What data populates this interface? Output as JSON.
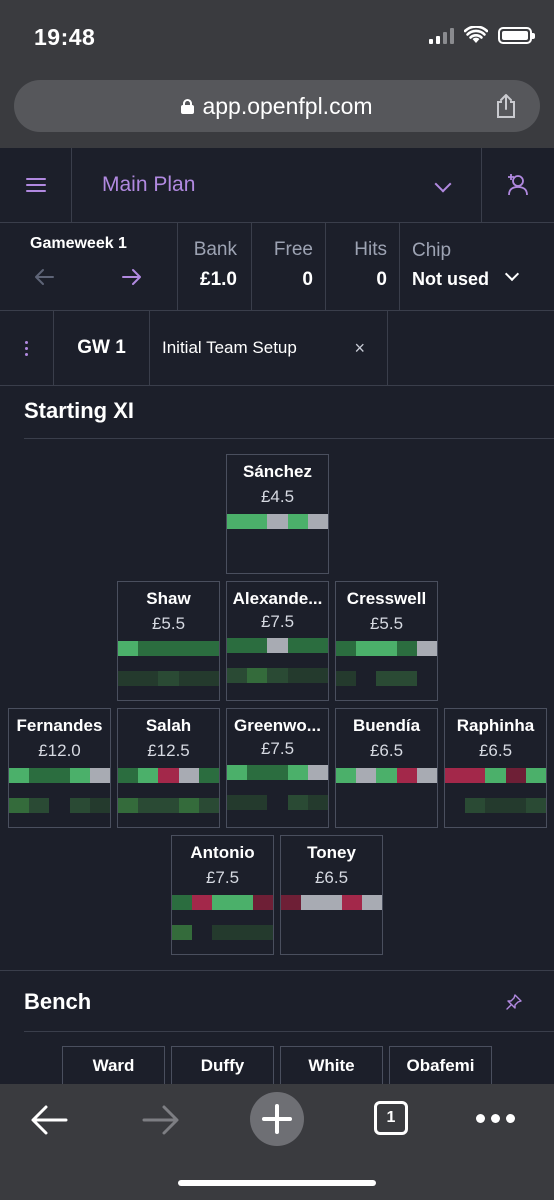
{
  "status": {
    "time": "19:48"
  },
  "browser": {
    "url": "app.openfpl.com",
    "tab_count": "1"
  },
  "header": {
    "plan_name": "Main Plan"
  },
  "gameweek": {
    "title": "Gameweek 1",
    "bank_label": "Bank",
    "bank_value": "£1.0",
    "free_label": "Free",
    "free_value": "0",
    "hits_label": "Hits",
    "hits_value": "0",
    "chip_label": "Chip",
    "chip_value": "Not used"
  },
  "tabs": {
    "gw": "GW 1",
    "setup": "Initial Team Setup",
    "close": "×"
  },
  "sections": {
    "starting": "Starting XI",
    "bench": "Bench"
  },
  "colors": {
    "accent": "#b189e0",
    "fixture_green": "#4bb06a",
    "fixture_dark_green": "#2b6d3f",
    "fixture_grey": "#a8abb3",
    "fixture_red": "#a3284a",
    "fixture_dark_red": "#6e1f36"
  },
  "players": [
    {
      "name": "Sánchez",
      "price": "£4.5"
    },
    {
      "name": "Shaw",
      "price": "£5.5"
    },
    {
      "name": "Alexande...",
      "price": "£7.5"
    },
    {
      "name": "Cresswell",
      "price": "£5.5"
    },
    {
      "name": "Fernandes",
      "price": "£12.0"
    },
    {
      "name": "Salah",
      "price": "£12.5"
    },
    {
      "name": "Greenwo...",
      "price": "£7.5"
    },
    {
      "name": "Buendía",
      "price": "£6.5"
    },
    {
      "name": "Raphinha",
      "price": "£6.5"
    },
    {
      "name": "Antonio",
      "price": "£7.5"
    },
    {
      "name": "Toney",
      "price": "£6.5"
    }
  ],
  "bench": [
    {
      "name": "Ward"
    },
    {
      "name": "Duffy"
    },
    {
      "name": "White"
    },
    {
      "name": "Obafemi"
    }
  ]
}
